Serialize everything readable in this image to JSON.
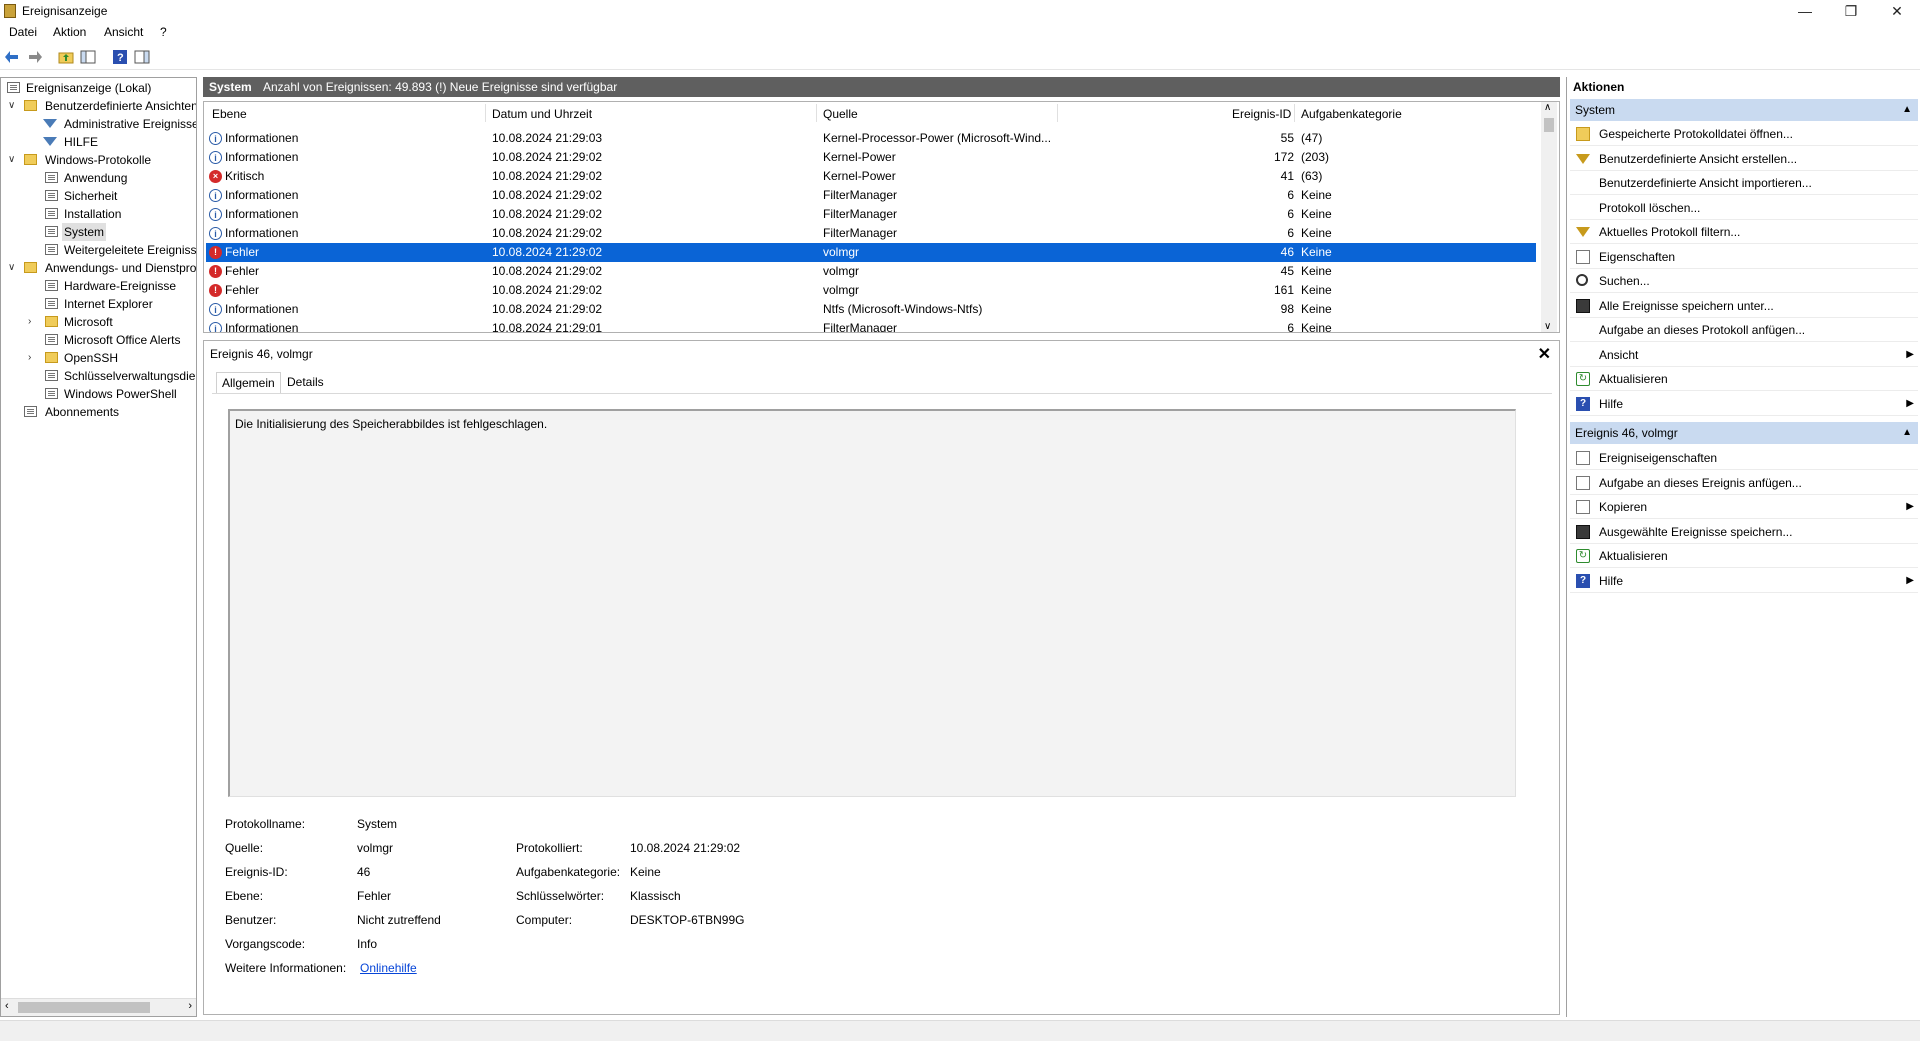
{
  "window": {
    "title": "Ereignisanzeige"
  },
  "menu": [
    "Datei",
    "Aktion",
    "Ansicht",
    "?"
  ],
  "tree": {
    "root": "Ereignisanzeige (Lokal)",
    "custom_views": "Benutzerdefinierte Ansichten",
    "admin_events": "Administrative Ereignisse",
    "hilfe": "HILFE",
    "windows_logs": "Windows-Protokolle",
    "app": "Anwendung",
    "security": "Sicherheit",
    "setup": "Installation",
    "system": "System",
    "forwarded": "Weitergeleitete Ereignisse",
    "app_services": "Anwendungs- und Dienstprotokolle",
    "hardware": "Hardware-Ereignisse",
    "ie": "Internet Explorer",
    "microsoft": "Microsoft",
    "office": "Microsoft Office Alerts",
    "openssh": "OpenSSH",
    "keymgmt": "Schlüsselverwaltungsdienst",
    "powershell": "Windows PowerShell",
    "subscriptions": "Abonnements"
  },
  "center": {
    "log_name": "System",
    "event_count": "Anzahl von Ereignissen: 49.893 (!) Neue Ereignisse sind verfügbar"
  },
  "table": {
    "columns": [
      "Ebene",
      "Datum und Uhrzeit",
      "Quelle",
      "Ereignis-ID",
      "Aufgabenkategorie"
    ],
    "rows": [
      {
        "level": "Informationen",
        "type": "info",
        "date": "10.08.2024 21:29:03",
        "source": "Kernel-Processor-Power (Microsoft-Wind...",
        "id": "55",
        "category": "(47)"
      },
      {
        "level": "Informationen",
        "type": "info",
        "date": "10.08.2024 21:29:02",
        "source": "Kernel-Power",
        "id": "172",
        "category": "(203)"
      },
      {
        "level": "Kritisch",
        "type": "crit",
        "date": "10.08.2024 21:29:02",
        "source": "Kernel-Power",
        "id": "41",
        "category": "(63)"
      },
      {
        "level": "Informationen",
        "type": "info",
        "date": "10.08.2024 21:29:02",
        "source": "FilterManager",
        "id": "6",
        "category": "Keine"
      },
      {
        "level": "Informationen",
        "type": "info",
        "date": "10.08.2024 21:29:02",
        "source": "FilterManager",
        "id": "6",
        "category": "Keine"
      },
      {
        "level": "Informationen",
        "type": "info",
        "date": "10.08.2024 21:29:02",
        "source": "FilterManager",
        "id": "6",
        "category": "Keine"
      },
      {
        "level": "Fehler",
        "type": "err",
        "date": "10.08.2024 21:29:02",
        "source": "volmgr",
        "id": "46",
        "category": "Keine"
      },
      {
        "level": "Fehler",
        "type": "err",
        "date": "10.08.2024 21:29:02",
        "source": "volmgr",
        "id": "45",
        "category": "Keine"
      },
      {
        "level": "Fehler",
        "type": "err",
        "date": "10.08.2024 21:29:02",
        "source": "volmgr",
        "id": "161",
        "category": "Keine"
      },
      {
        "level": "Informationen",
        "type": "info",
        "date": "10.08.2024 21:29:02",
        "source": "Ntfs (Microsoft-Windows-Ntfs)",
        "id": "98",
        "category": "Keine"
      },
      {
        "level": "Informationen",
        "type": "info",
        "date": "10.08.2024 21:29:01",
        "source": "FilterManager",
        "id": "6",
        "category": "Keine"
      }
    ]
  },
  "detail": {
    "title": "Ereignis 46, volmgr",
    "tabs": [
      "Allgemein",
      "Details"
    ],
    "message": "Die Initialisierung des Speicherabbildes ist fehlgeschlagen.",
    "labels": {
      "log_name": "Protokollname:",
      "source": "Quelle:",
      "event_id": "Ereignis-ID:",
      "level": "Ebene:",
      "user": "Benutzer:",
      "opcode": "Vorgangscode:",
      "more_info": "Weitere Informationen:",
      "logged": "Protokolliert:",
      "task_cat": "Aufgabenkategorie:",
      "keywords": "Schlüsselwörter:",
      "computer": "Computer:"
    },
    "values": {
      "log_name": "System",
      "source": "volmgr",
      "event_id": "46",
      "level": "Fehler",
      "user": "Nicht zutreffend",
      "opcode": "Info",
      "more_info": "Onlinehilfe",
      "logged": "10.08.2024 21:29:02",
      "task_cat": "Keine",
      "keywords": "Klassisch",
      "computer": "DESKTOP-6TBN99G"
    }
  },
  "actions": {
    "header": "Aktionen",
    "section1": "System",
    "items1": [
      {
        "label": "Gespeicherte Protokolldatei öffnen...",
        "icon": "folder-icon"
      },
      {
        "label": "Benutzerdefinierte Ansicht erstellen...",
        "icon": "filter-icon"
      },
      {
        "label": "Benutzerdefinierte Ansicht importieren...",
        "icon": ""
      },
      {
        "label": "Protokoll löschen...",
        "icon": ""
      },
      {
        "label": "Aktuelles Protokoll filtern...",
        "icon": "filter-icon"
      },
      {
        "label": "Eigenschaften",
        "icon": "properties-icon"
      },
      {
        "label": "Suchen...",
        "icon": "search-icon"
      },
      {
        "label": "Alle Ereignisse speichern unter...",
        "icon": "save-icon"
      },
      {
        "label": "Aufgabe an dieses Protokoll anfügen...",
        "icon": ""
      },
      {
        "label": "Ansicht",
        "icon": "",
        "submenu": true
      },
      {
        "label": "Aktualisieren",
        "icon": "refresh-icon"
      },
      {
        "label": "Hilfe",
        "icon": "help-icon",
        "submenu": true
      }
    ],
    "section2": "Ereignis 46, volmgr",
    "items2": [
      {
        "label": "Ereigniseigenschaften",
        "icon": "properties-icon"
      },
      {
        "label": "Aufgabe an dieses Ereignis anfügen...",
        "icon": "task-icon"
      },
      {
        "label": "Kopieren",
        "icon": "copy-icon",
        "submenu": true
      },
      {
        "label": "Ausgewählte Ereignisse speichern...",
        "icon": "save-icon"
      },
      {
        "label": "Aktualisieren",
        "icon": "refresh-icon"
      },
      {
        "label": "Hilfe",
        "icon": "help-icon",
        "submenu": true
      }
    ]
  }
}
